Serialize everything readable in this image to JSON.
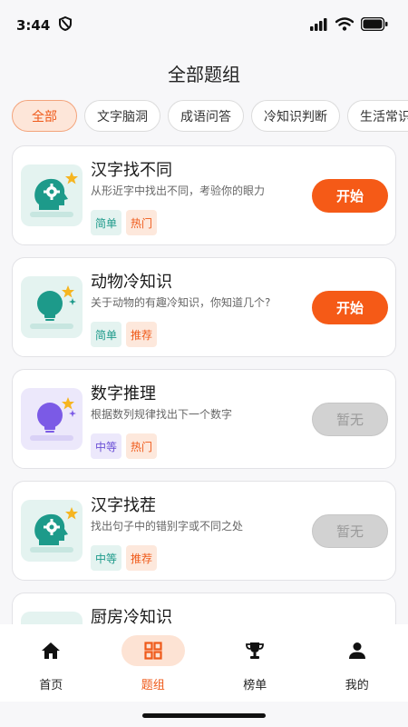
{
  "status": {
    "time": "3:44"
  },
  "header": {
    "title": "全部题组"
  },
  "filters": [
    "全部",
    "文字脑洞",
    "成语问答",
    "冷知识判断",
    "生活常识"
  ],
  "cards": [
    {
      "title": "汉字找不同",
      "desc": "从形近字中找出不同，考验你的眼力",
      "tags": [
        "简单",
        "热门"
      ],
      "button": "开始"
    },
    {
      "title": "动物冷知识",
      "desc": "关于动物的有趣冷知识，你知道几个?",
      "tags": [
        "简单",
        "推荐"
      ],
      "button": "开始"
    },
    {
      "title": "数字推理",
      "desc": "根据数列规律找出下一个数字",
      "tags": [
        "中等",
        "热门"
      ],
      "button": "暂无"
    },
    {
      "title": "汉字找茬",
      "desc": "找出句子中的错别字或不同之处",
      "tags": [
        "中等",
        "推荐"
      ],
      "button": "暂无"
    },
    {
      "title": "厨房冷知识",
      "desc": "",
      "tags": [],
      "button": ""
    }
  ],
  "tabbar": {
    "items": [
      "首页",
      "题组",
      "榜单",
      "我的"
    ]
  },
  "colors": {
    "accent": "#f55a17",
    "teal": "#1d9a8a",
    "purple": "#7b5ae6"
  }
}
